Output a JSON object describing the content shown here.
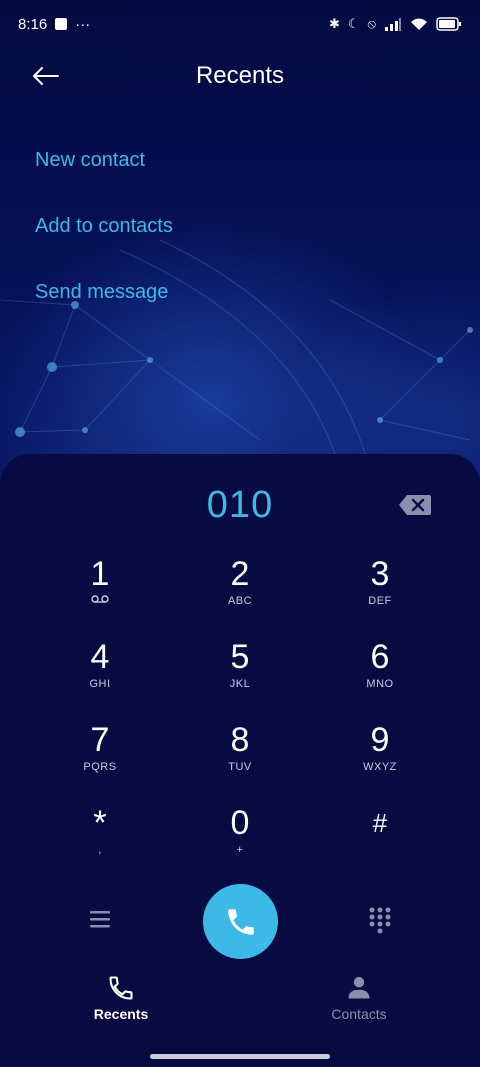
{
  "status_bar": {
    "time": "8:16",
    "indicators": [
      "bluetooth-icon",
      "moon-icon",
      "silent-icon",
      "signal-icon",
      "wifi-icon",
      "battery-icon"
    ],
    "more": "···"
  },
  "header": {
    "title": "Recents",
    "back_icon": "arrow-left-icon"
  },
  "menu": {
    "items": [
      {
        "label": "New contact"
      },
      {
        "label": "Add to contacts"
      },
      {
        "label": "Send message"
      }
    ]
  },
  "dialer": {
    "number": "010",
    "keys": [
      {
        "digit": "1",
        "letters": ""
      },
      {
        "digit": "2",
        "letters": "ABC"
      },
      {
        "digit": "3",
        "letters": "DEF"
      },
      {
        "digit": "4",
        "letters": "GHI"
      },
      {
        "digit": "5",
        "letters": "JKL"
      },
      {
        "digit": "6",
        "letters": "MNO"
      },
      {
        "digit": "7",
        "letters": "PQRS"
      },
      {
        "digit": "8",
        "letters": "TUV"
      },
      {
        "digit": "9",
        "letters": "WXYZ"
      },
      {
        "digit": "*",
        "letters": ","
      },
      {
        "digit": "0",
        "letters": "+"
      },
      {
        "digit": "#",
        "letters": ""
      }
    ]
  },
  "bottom_nav": {
    "recents": "Recents",
    "contacts": "Contacts"
  },
  "colors": {
    "accent": "#3fb8e8",
    "background": "#04083a",
    "dialer_bg": "#070b42"
  }
}
